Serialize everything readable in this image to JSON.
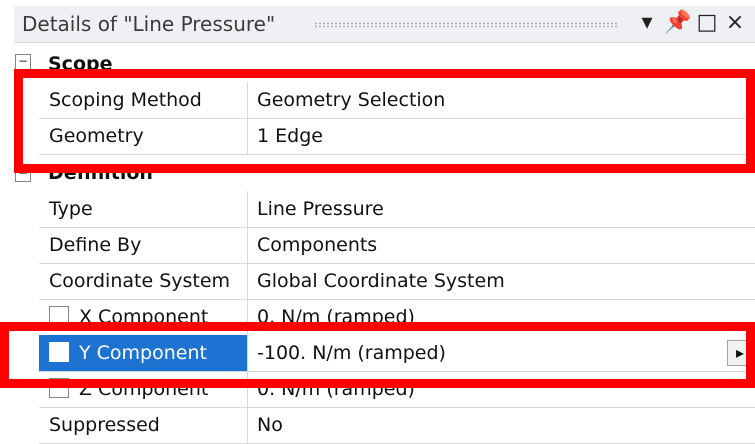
{
  "window": {
    "title": "Details of \"Line Pressure\"",
    "icons": [
      "chevron-down-icon",
      "pin-icon",
      "maximize-icon",
      "close-icon"
    ]
  },
  "groups": [
    {
      "name": "Scope",
      "rows": [
        {
          "label": "Scoping Method",
          "value": "Geometry Selection"
        },
        {
          "label": "Geometry",
          "value": "1 Edge"
        }
      ]
    },
    {
      "name": "Definition",
      "rows": [
        {
          "label": "Type",
          "value": "Line Pressure"
        },
        {
          "label": "Define By",
          "value": "Components"
        },
        {
          "label": "Coordinate System",
          "value": "Global Coordinate System"
        },
        {
          "label": "X Component",
          "value": "0. N/m  (ramped)"
        },
        {
          "label": "Y Component",
          "value": "-100. N/m  (ramped)"
        },
        {
          "label": "Z Component",
          "value": "0. N/m  (ramped)"
        },
        {
          "label": "Suppressed",
          "value": "No"
        }
      ]
    }
  ],
  "colors": {
    "selection": "#1d73d2",
    "highlight_box": "#ff0000"
  }
}
